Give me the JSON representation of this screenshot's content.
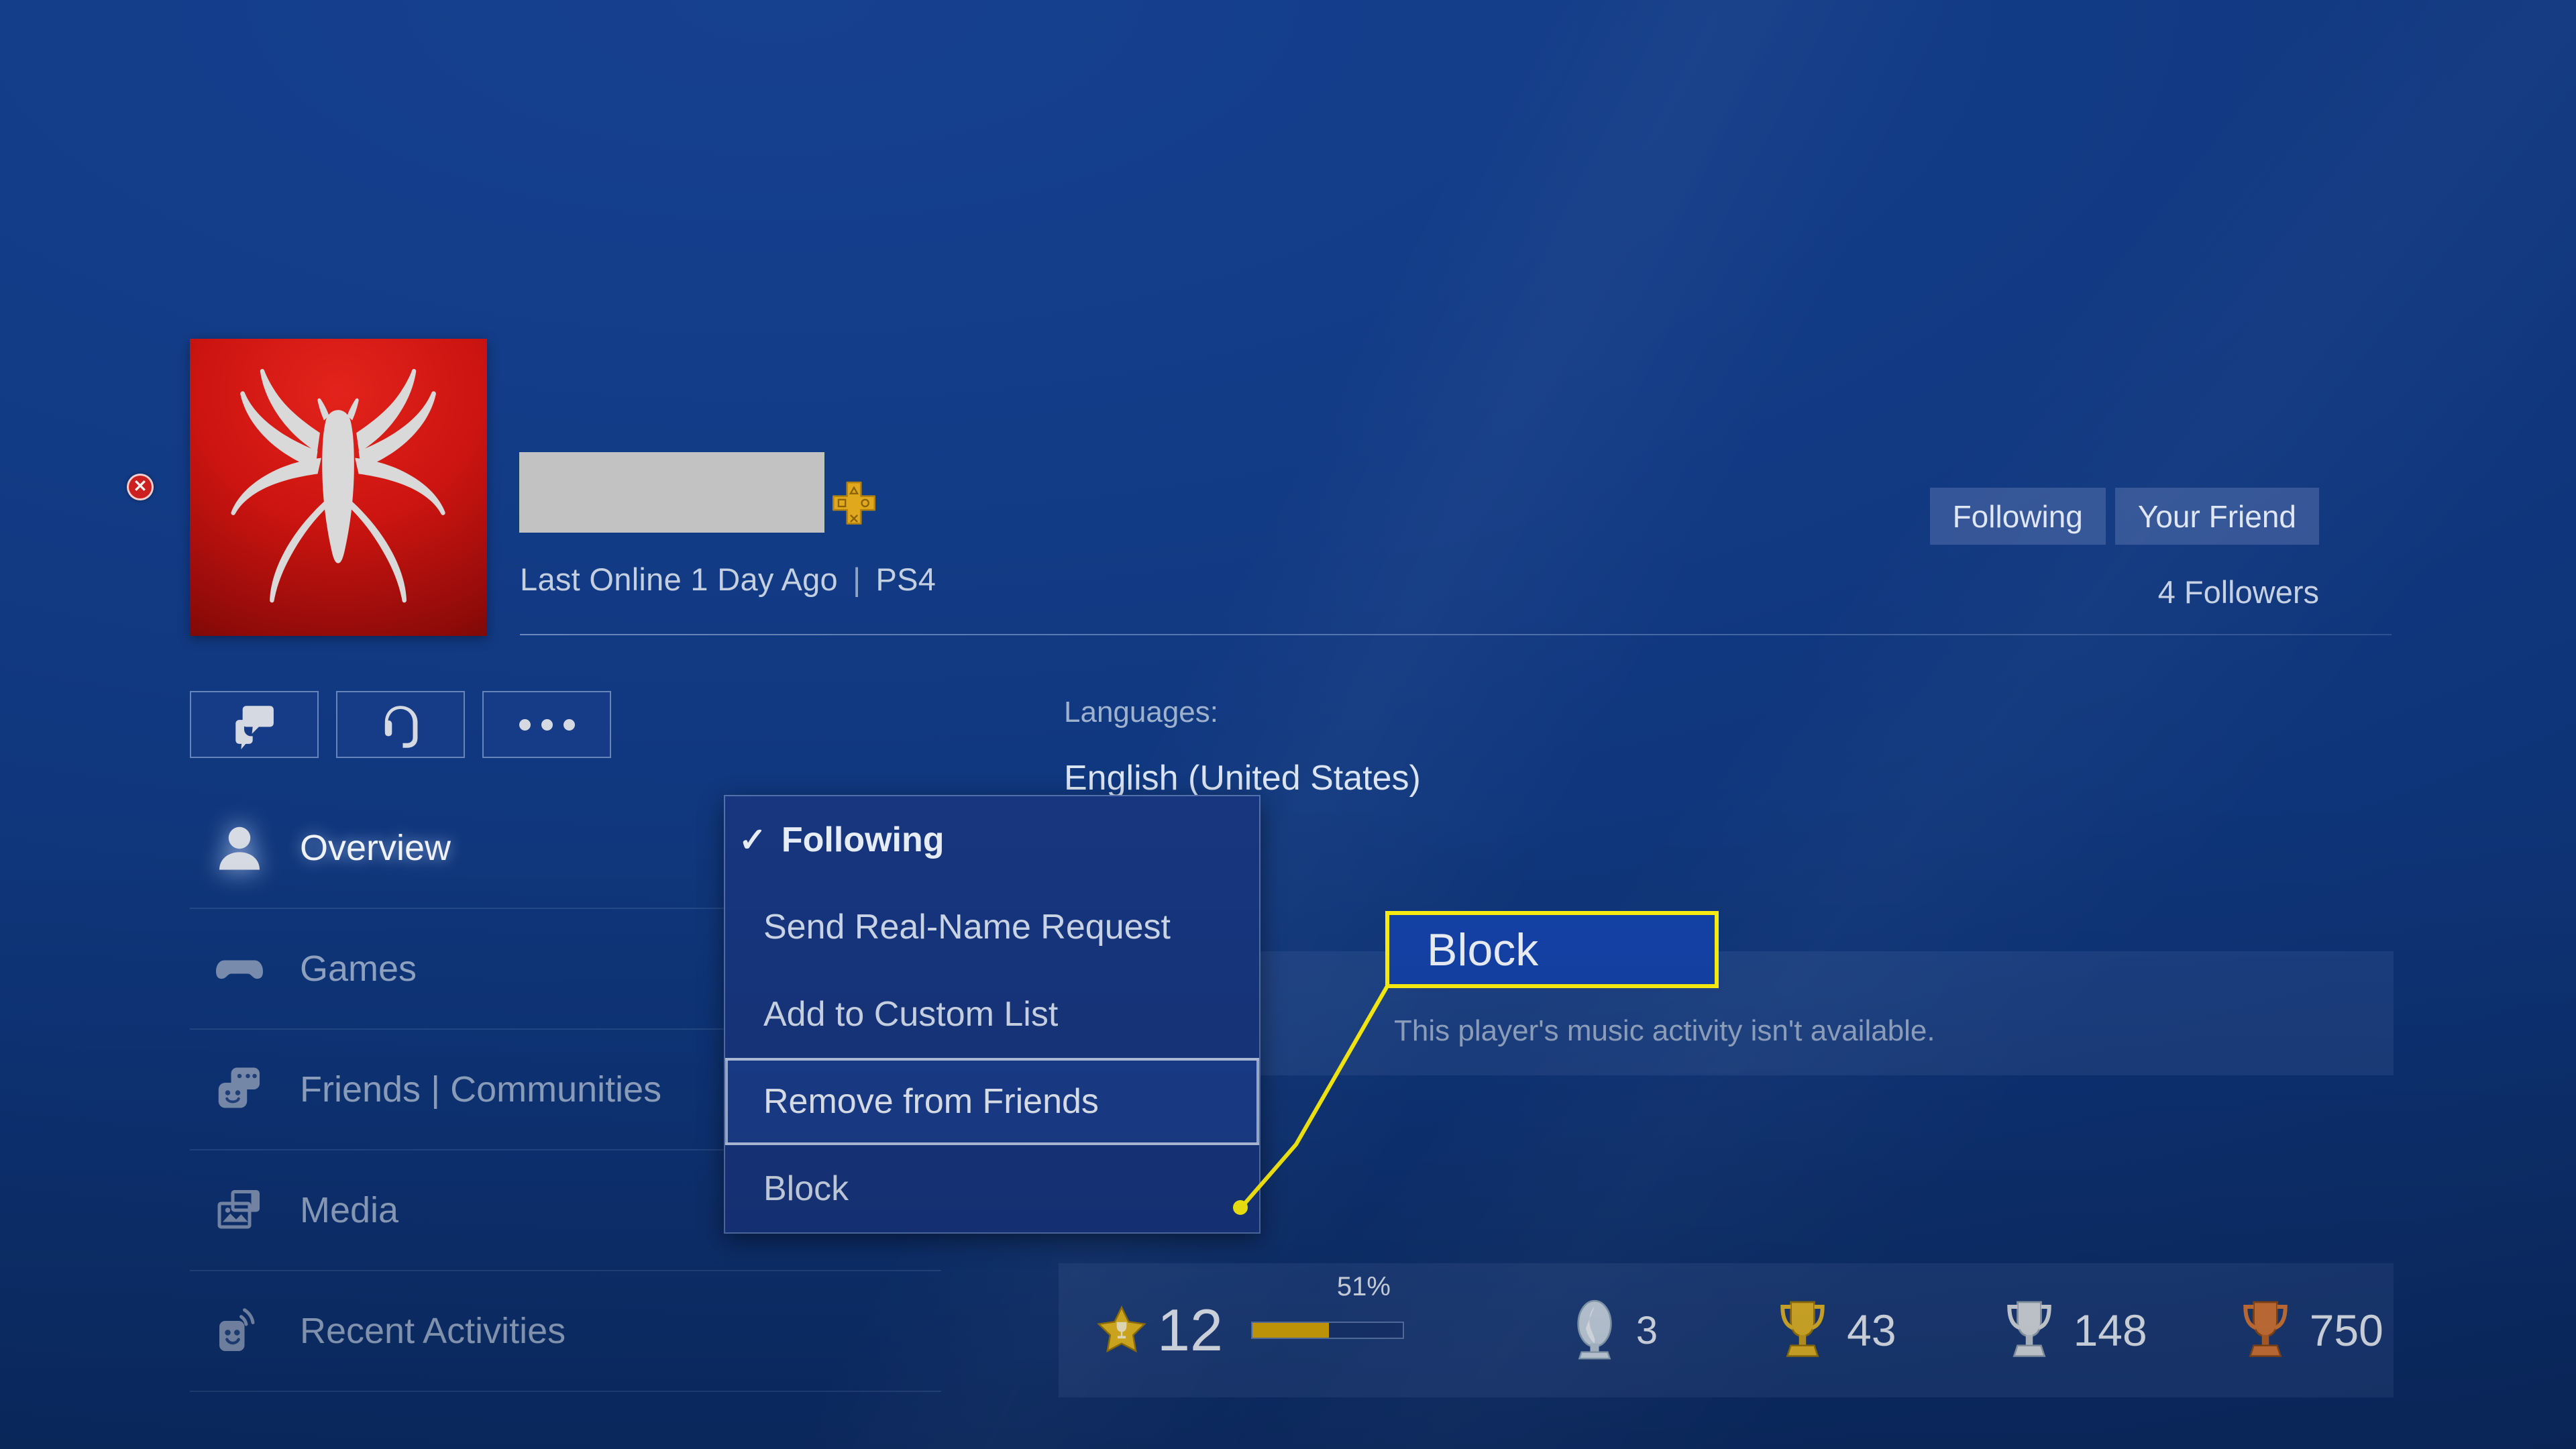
{
  "window": {
    "close_icon": "close-circle-x-icon"
  },
  "profile": {
    "avatar_icon": "spider-emblem-avatar",
    "username_redacted": "",
    "ps_plus_icon": "playstation-plus-icon",
    "last_online": "Last Online 1 Day Ago",
    "separator": "|",
    "platform": "PS4",
    "followers": "4 Followers",
    "relationship_buttons": [
      {
        "label": "Following",
        "name": "following-button"
      },
      {
        "label": "Your Friend",
        "name": "your-friend-button"
      }
    ]
  },
  "actions": [
    {
      "name": "send-message-button",
      "icon": "chat-bubbles-icon"
    },
    {
      "name": "party-chat-button",
      "icon": "headset-icon"
    },
    {
      "name": "more-options-button",
      "icon": "ellipsis-icon"
    }
  ],
  "sidebar": {
    "items": [
      {
        "label": "Overview",
        "icon": "person-icon",
        "active": true
      },
      {
        "label": "Games",
        "icon": "controller-icon",
        "active": false
      },
      {
        "label": "Friends | Communities",
        "icon": "friends-icon",
        "active": false
      },
      {
        "label": "Media",
        "icon": "media-icon",
        "active": false
      },
      {
        "label": "Recent Activities",
        "icon": "activity-icon",
        "active": false
      }
    ]
  },
  "details": {
    "languages_label": "Languages:",
    "languages_value": "English (United States)",
    "music_activity": "This player's music activity isn't available."
  },
  "context_menu": {
    "items": [
      {
        "label": "Following",
        "checked": true,
        "selected": false,
        "check_glyph": "✓"
      },
      {
        "label": "Send Real-Name Request",
        "checked": false,
        "selected": false
      },
      {
        "label": "Add to Custom List",
        "checked": false,
        "selected": false
      },
      {
        "label": "Remove from Friends",
        "checked": false,
        "selected": true
      },
      {
        "label": "Block",
        "checked": false,
        "selected": false
      }
    ]
  },
  "callout": {
    "label": "Block",
    "border_color": "#fff212",
    "fill_color": "#1442a8",
    "line_color": "#fff212"
  },
  "trophies": {
    "level_icon": "star-trophy-level-icon",
    "level": "12",
    "progress_percent": "51%",
    "progress_value": 51,
    "platinum": {
      "icon": "platinum-trophy-icon",
      "count": "3"
    },
    "gold": {
      "icon": "gold-trophy-icon",
      "count": "43"
    },
    "silver": {
      "icon": "silver-trophy-icon",
      "count": "148"
    },
    "bronze": {
      "icon": "bronze-trophy-icon",
      "count": "750"
    }
  },
  "colors": {
    "background": "#0e3478",
    "panel": "rgba(130,155,210,0.12)",
    "accent_yellow": "#fff212",
    "progress_gold": "#d9a80a",
    "avatar_red": "#cc1410"
  }
}
